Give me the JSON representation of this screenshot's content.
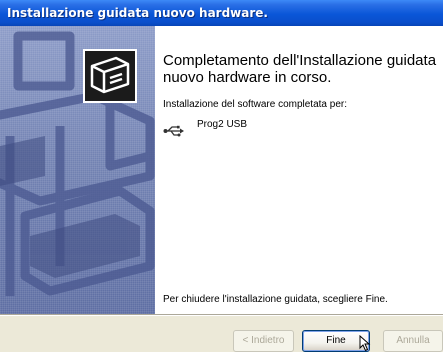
{
  "window": {
    "title": "Installazione guidata nuovo hardware."
  },
  "main": {
    "heading": "Completamento dell'Installazione guidata nuovo hardware in corso.",
    "subtext": "Installazione del software completata per:",
    "device_name": "Prog2 USB",
    "device_icon": "usb-icon",
    "footer_text": "Per chiudere l'installazione guidata, scegliere Fine."
  },
  "buttons": {
    "back_label": "< Indietro",
    "finish_label": "Fine",
    "cancel_label": "Annulla"
  },
  "colors": {
    "titlebar": "#0a56d8",
    "side_panel": "#7383b3",
    "dialog_bg": "#ece9d8"
  }
}
